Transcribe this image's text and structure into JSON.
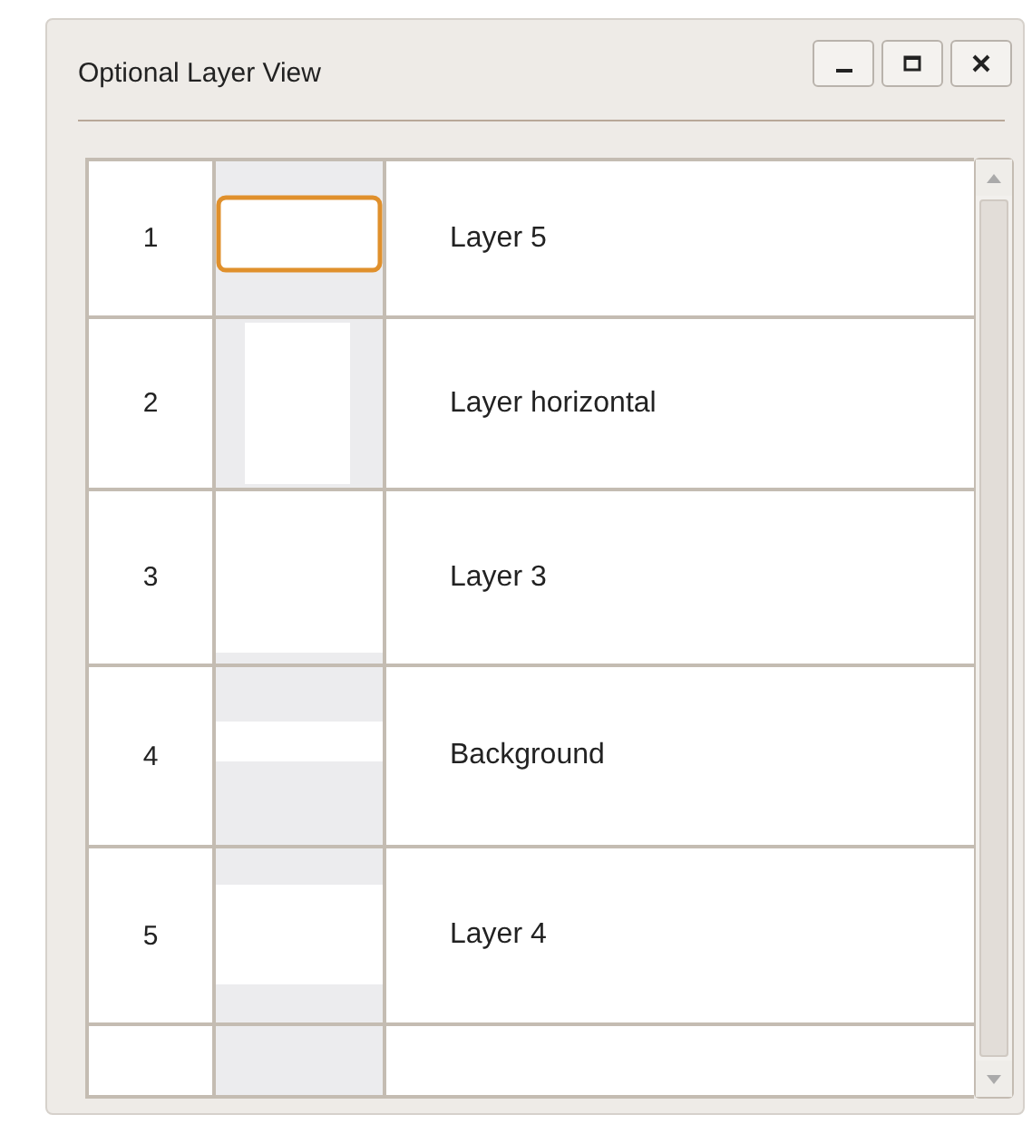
{
  "window": {
    "title": "Optional Layer View"
  },
  "layers": [
    {
      "number": "1",
      "name": "Layer 5",
      "selected": true
    },
    {
      "number": "2",
      "name": "Layer horizontal",
      "selected": false
    },
    {
      "number": "3",
      "name": "Layer 3",
      "selected": false
    },
    {
      "number": "4",
      "name": "Background",
      "selected": false
    },
    {
      "number": "5",
      "name": "Layer 4",
      "selected": false
    }
  ]
}
